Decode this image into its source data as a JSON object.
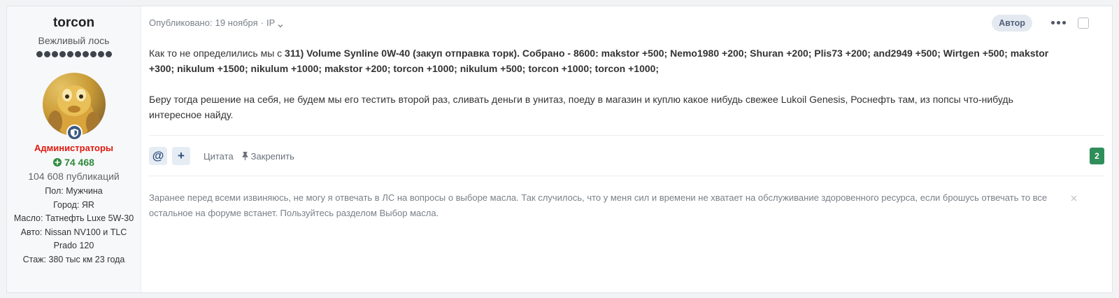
{
  "author": {
    "name": "torcon",
    "title": "Вежливый лось",
    "rank_pips": 10,
    "group": "Администраторы",
    "reputation": "74 468",
    "posts": "104 608 публикаций",
    "fields": [
      {
        "label": "Пол:",
        "value": "Мужчина"
      },
      {
        "label": "Город:",
        "value": "ЯR"
      },
      {
        "label": "Масло:",
        "value": "Татнефть Luxe 5W-30"
      },
      {
        "label": "Авто:",
        "value": "Nissan NV100 и TLC Prado 120"
      },
      {
        "label": "Стаж:",
        "value": "380 тыс км 23 года"
      }
    ],
    "icons": {
      "badge": "shield-icon",
      "reputation": "plus-circle-icon"
    },
    "colors": {
      "group": "#e0190f",
      "reputation": "#2e8b3e",
      "badge": "#3d5a80"
    }
  },
  "post": {
    "published_label": "Опубликовано:",
    "date": "19 ноября",
    "separator": "·",
    "ip_label": "IP",
    "author_tag": "Автор",
    "body": {
      "p1_intro": "Как то не определились мы с ",
      "p1_bold": "311) Volume Synline 0W-40 (закуп отправка торк). Собрано - 8600: makstor +500; Nemo1980 +200; Shuran +200; Plis73 +200; and2949 +500; Wirtgen +500; makstor +300; nikulum +1500; nikulum +1000; makstor +200; torcon +1000; nikulum +500; torcon +1000; torcon +1000;",
      "p2": "Беру тогда решение на себя, не будем мы его тестить второй раз, сливать деньги в унитаз, поеду в магазин и куплю какое нибудь свежее Lukoil Genesis, Роснефть там, из попсы что-нибудь интересное найду."
    },
    "actions": {
      "mention_label": "@",
      "add_label": "+",
      "quote_label": "Цитата",
      "pin_label": "Закрепить",
      "count": "2"
    },
    "signature": "Заранее перед всеми извиняюсь, не могу я отвечать в ЛС на вопросы о выборе масла. Так случилось, что у меня сил и времени не хватает на обслуживание здоровенного ресурса, если брошусь отвечать то все остальное на форуме встанет. Пользуйтесь разделом Выбор масла.",
    "colors": {
      "count_badge": "#2f8e5a",
      "author_tag_bg": "#e4e9f1"
    }
  }
}
